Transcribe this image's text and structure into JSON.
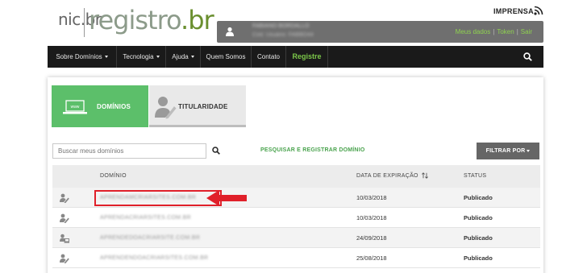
{
  "header": {
    "logo_nic": "nic.br",
    "logo_registro": "registro",
    "logo_br": ".br",
    "imprensa": "IMPRENSA"
  },
  "user": {
    "name": "FABIANO BORDALLO",
    "sub": "Cód. Usuário: FABBO44",
    "links": [
      "Meus dados",
      "Token",
      "Sair"
    ]
  },
  "nav": {
    "items": [
      {
        "label": "Sobre Domínios",
        "dropdown": true
      },
      {
        "label": "Tecnologia",
        "dropdown": true
      },
      {
        "label": "Ajuda",
        "dropdown": true
      },
      {
        "label": "Quem Somos",
        "dropdown": false
      },
      {
        "label": "Contato",
        "dropdown": false
      },
      {
        "label": "Registre",
        "dropdown": false
      }
    ]
  },
  "tabs": {
    "dominios": "DOMÍNIOS",
    "titularidade": "TITULARIDADE"
  },
  "search": {
    "placeholder": "Buscar meus domínios",
    "register_link": "PESQUISAR E REGISTRAR DOMÍNIO",
    "filter_label": "FILTRAR POR"
  },
  "table": {
    "headers": {
      "domain": "DOMÍNIO",
      "expiration": "DATA DE EXPIRAÇÃO",
      "status": "STATUS"
    },
    "rows": [
      {
        "domain": "APRENDAMCRIARSITES.COM.BR",
        "expiration": "10/03/2018",
        "status": "Publicado",
        "icon": "edit-person-icon"
      },
      {
        "domain": "APRENDACRIARSITES.COM.BR",
        "expiration": "10/03/2018",
        "status": "Publicado",
        "icon": "edit-person-icon"
      },
      {
        "domain": "APRENDEDOACRIARSITE.COM.BR",
        "expiration": "24/09/2018",
        "status": "Publicado",
        "icon": "network-person-icon"
      },
      {
        "domain": "APRENDENDOACRIARSITES.COM.BR",
        "expiration": "25/08/2018",
        "status": "Publicado",
        "icon": "edit-person-icon"
      }
    ]
  },
  "colors": {
    "accent_green": "#5cbf6a",
    "nav_bg": "#1a1a1a",
    "highlight_red": "#e0202a"
  }
}
